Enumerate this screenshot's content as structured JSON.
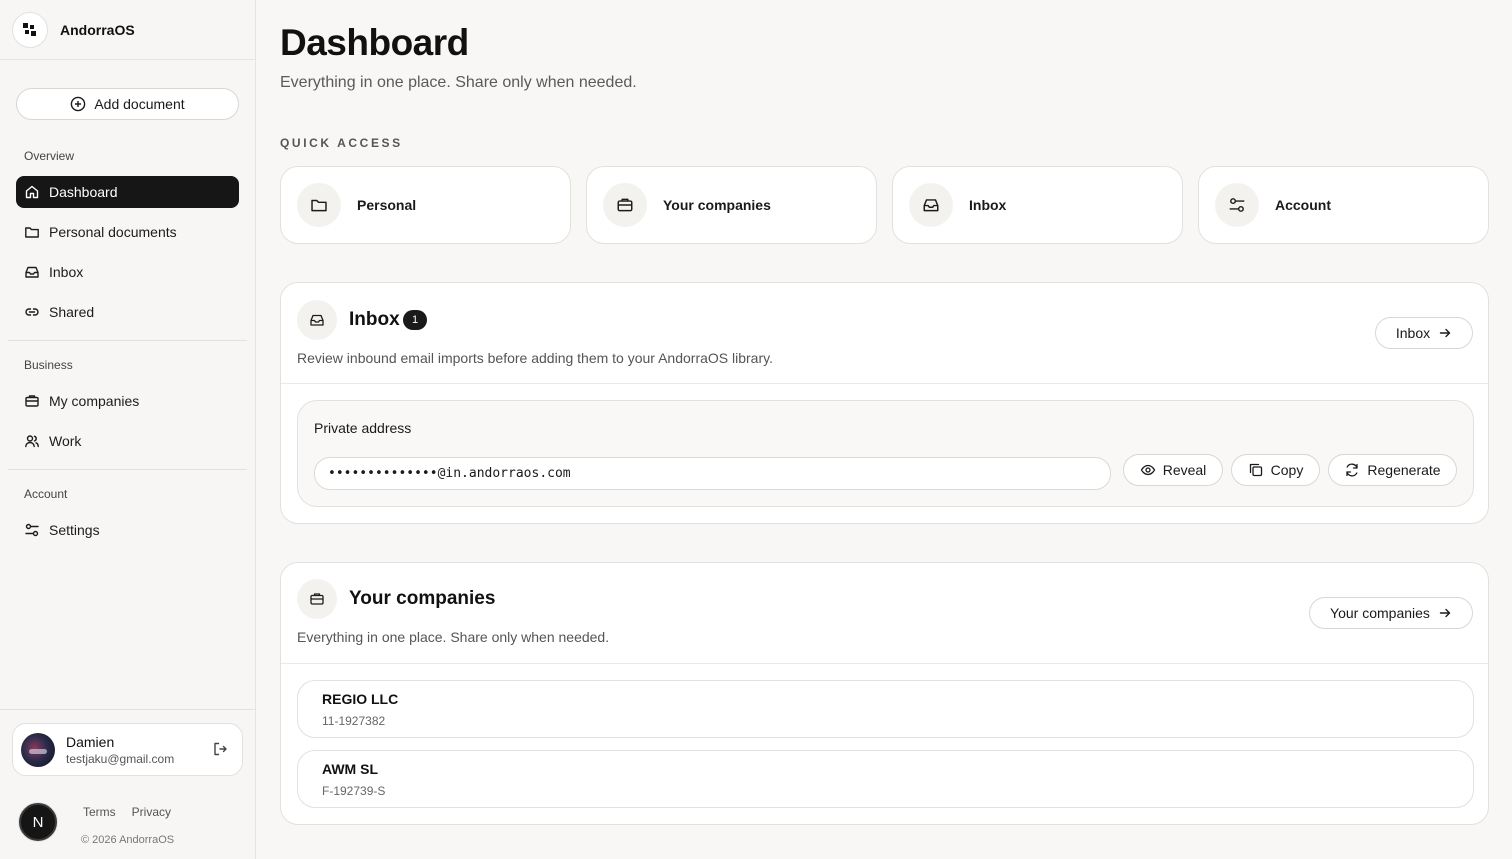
{
  "app": {
    "name": "AndorraOS"
  },
  "sidebar": {
    "add_document": "Add document",
    "groups": [
      {
        "label": "Overview"
      },
      {
        "label": "Business"
      },
      {
        "label": "Account"
      }
    ],
    "items": [
      {
        "label": "Dashboard",
        "icon": "home-icon",
        "active": true
      },
      {
        "label": "Personal documents",
        "icon": "folder-icon"
      },
      {
        "label": "Inbox",
        "icon": "inbox-icon"
      },
      {
        "label": "Shared",
        "icon": "link-icon"
      },
      {
        "label": "My companies",
        "icon": "briefcase-icon"
      },
      {
        "label": "Work",
        "icon": "users-icon"
      },
      {
        "label": "Settings",
        "icon": "sliders-icon"
      }
    ],
    "user": {
      "name": "Damien",
      "email": "testjaku@gmail.com"
    },
    "avatar_letter": "N",
    "footer": {
      "terms": "Terms",
      "privacy": "Privacy",
      "copyright": "© 2026 AndorraOS"
    }
  },
  "main": {
    "title": "Dashboard",
    "subtitle": "Everything in one place. Share only when needed.",
    "quick_access": {
      "label": "QUICK ACCESS",
      "cards": [
        {
          "label": "Personal",
          "icon": "folder-icon"
        },
        {
          "label": "Your companies",
          "icon": "briefcase-icon"
        },
        {
          "label": "Inbox",
          "icon": "inbox-icon"
        },
        {
          "label": "Account",
          "icon": "sliders-icon"
        }
      ]
    },
    "inbox": {
      "title": "Inbox",
      "count": "1",
      "description": "Review inbound email imports before adding them to your AndorraOS library.",
      "button": "Inbox",
      "address_label": "Private address",
      "address_value": "••••••••••••••@in.andorraos.com",
      "reveal": "Reveal",
      "copy": "Copy",
      "regenerate": "Regenerate"
    },
    "companies": {
      "title": "Your companies",
      "description": "Everything in one place. Share only when needed.",
      "button": "Your companies",
      "list": [
        {
          "name": "REGIO LLC",
          "id": "11-1927382"
        },
        {
          "name": "AWM SL",
          "id": "F-192739-S"
        }
      ]
    }
  },
  "colors": {
    "active_bg": "#161616",
    "background": "#f8f7f5",
    "card": "#ffffff",
    "border": "#e3e1dd"
  }
}
